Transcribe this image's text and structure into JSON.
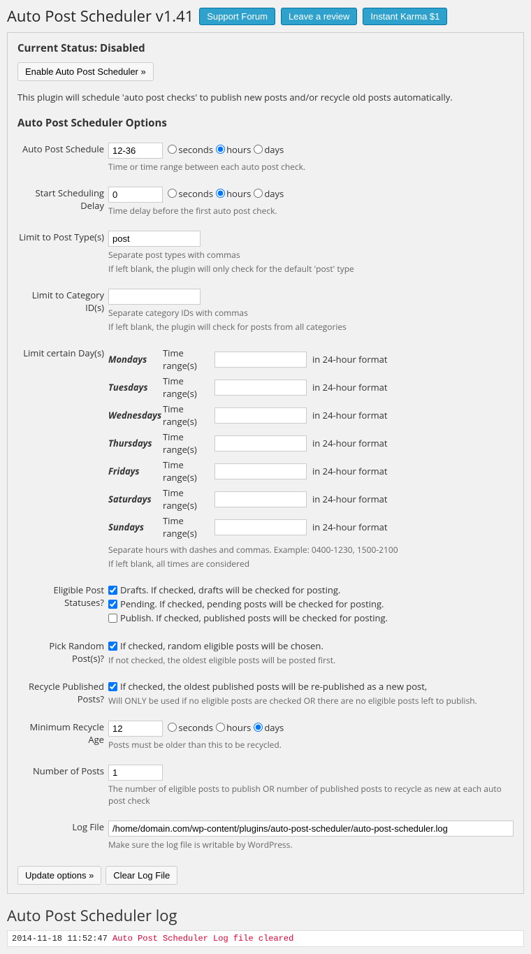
{
  "header": {
    "title": "Auto Post Scheduler v1.41",
    "buttons": {
      "support": "Support Forum",
      "review": "Leave a review",
      "karma": "Instant Karma $1"
    }
  },
  "status": {
    "label": "Current Status:",
    "value": "Disabled",
    "enable_btn": "Enable Auto Post Scheduler »",
    "plugin_desc": "This plugin will schedule 'auto post checks' to publish new posts and/or recycle old posts automatically."
  },
  "options": {
    "section_title": "Auto Post Scheduler Options",
    "schedule": {
      "label": "Auto Post Schedule",
      "value": "12-36",
      "units": {
        "seconds": "seconds",
        "hours": "hours",
        "days": "days"
      },
      "hint": "Time or time range between each auto post check."
    },
    "delay": {
      "label": "Start Scheduling Delay",
      "value": "0",
      "hint": "Time delay before the first auto post check."
    },
    "post_types": {
      "label": "Limit to Post Type(s)",
      "value": "post",
      "hint1": "Separate post types with commas",
      "hint2": "If left blank, the plugin will only check for the default 'post' type"
    },
    "category_ids": {
      "label": "Limit to Category ID(s)",
      "value": "",
      "hint1": "Separate category IDs with commas",
      "hint2": "If left blank, the plugin will check for posts from all categories"
    },
    "days": {
      "label": "Limit certain Day(s)",
      "tr_label": "Time range(s)",
      "after": "in 24-hour format",
      "names": {
        "mon": "Mondays",
        "tue": "Tuesdays",
        "wed": "Wednesdays",
        "thu": "Thursdays",
        "fri": "Fridays",
        "sat": "Saturdays",
        "sun": "Sundays"
      },
      "hint1": "Separate hours with dashes and commas. Example: 0400-1230, 1500-2100",
      "hint2": "If left blank, all times are considered"
    },
    "statuses": {
      "label": "Eligible Post Statuses?",
      "drafts": "Drafts. If checked, drafts will be checked for posting.",
      "pending": "Pending. If checked, pending posts will be checked for posting.",
      "publish": "Publish. If checked, published posts will be checked for posting."
    },
    "random": {
      "label": "Pick Random Post(s)?",
      "text": "If checked, random eligible posts will be chosen.",
      "hint": "If not checked, the oldest eligible posts will be posted first."
    },
    "recycle": {
      "label": "Recycle Published Posts?",
      "text": "If checked, the oldest published posts will be re-published as a new post,",
      "hint": "Will ONLY be used if no eligible posts are checked OR there are no eligible posts left to publish."
    },
    "min_age": {
      "label": "Minimum Recycle Age",
      "value": "12",
      "hint": "Posts must be older than this to be recycled."
    },
    "num_posts": {
      "label": "Number of Posts",
      "value": "1",
      "hint": "The number of eligible posts to publish OR number of published posts to recycle as new at each auto post check"
    },
    "logfile": {
      "label": "Log File",
      "value": "/home/domain.com/wp-content/plugins/auto-post-scheduler/auto-post-scheduler.log",
      "hint": "Make sure the log file is writable by WordPress."
    }
  },
  "actions": {
    "update": "Update options »",
    "clear": "Clear Log File"
  },
  "log": {
    "title": "Auto Post Scheduler log",
    "ts": "2014-11-18 11:52:47",
    "msg": "Auto Post Scheduler Log file cleared"
  }
}
